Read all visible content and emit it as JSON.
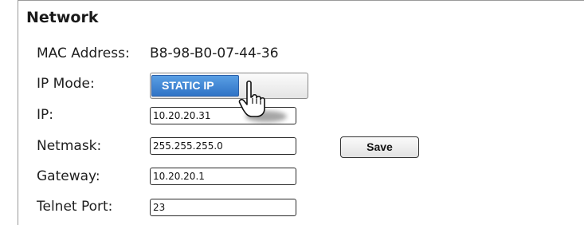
{
  "section": {
    "title": "Network"
  },
  "mac": {
    "label": "MAC Address:",
    "value": "B8-98-B0-07-44-36"
  },
  "ip_mode": {
    "label": "IP Mode:",
    "selected": "STATIC IP"
  },
  "ip": {
    "label": "IP:",
    "value": "10.20.20.31"
  },
  "netmask": {
    "label": "Netmask:",
    "value": "255.255.255.0"
  },
  "gateway": {
    "label": "Gateway:",
    "value": "10.20.20.1"
  },
  "telnet_port": {
    "label": "Telnet Port:",
    "value": "23"
  },
  "actions": {
    "save_label": "Save"
  },
  "colors": {
    "toggle_active": "#3d86d6",
    "border": "#2a2a2a"
  },
  "icons": {
    "cursor": "hand-pointer-icon"
  }
}
